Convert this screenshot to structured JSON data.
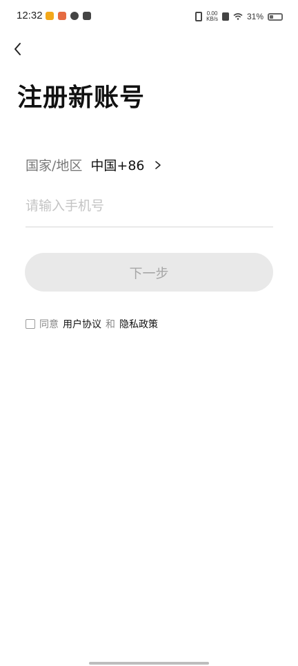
{
  "status_bar": {
    "time": "12:32",
    "speed_top": "0.00",
    "speed_bottom": "KB/s",
    "battery": "31%"
  },
  "page": {
    "title": "注册新账号"
  },
  "country": {
    "label": "国家/地区",
    "value": "中国+86"
  },
  "phone": {
    "placeholder": "请输入手机号",
    "value": ""
  },
  "actions": {
    "next_label": "下一步"
  },
  "agreement": {
    "agree": "同意",
    "user_agreement": "用户协议",
    "and": "和",
    "privacy_policy": "隐私政策"
  }
}
